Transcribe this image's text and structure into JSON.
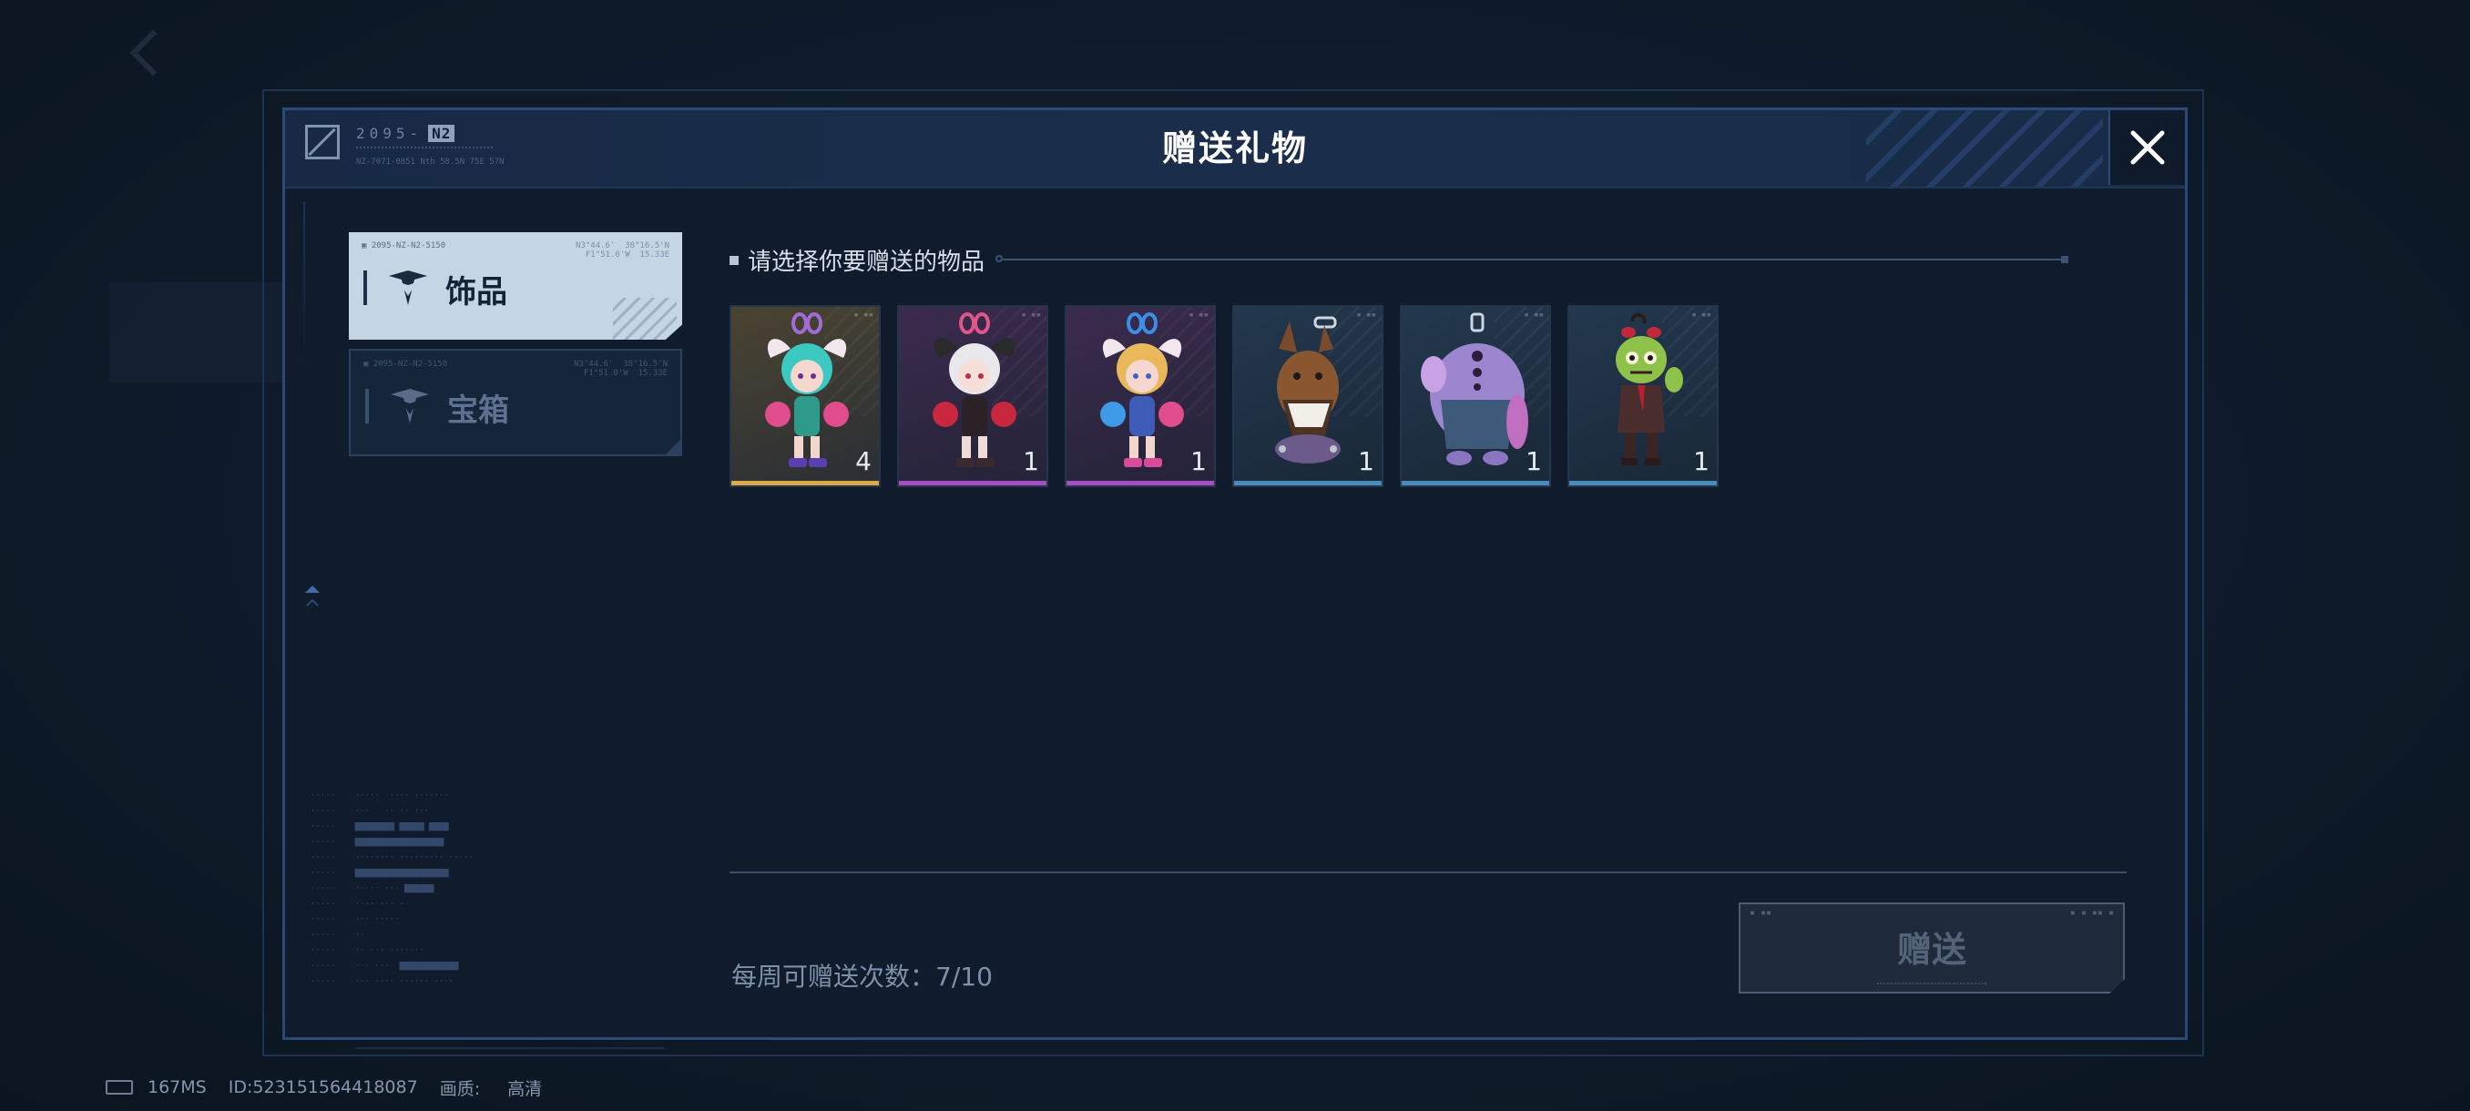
{
  "dialog": {
    "title": "赠送礼物",
    "close_icon": "close-icon",
    "logo": {
      "code": "2095-",
      "tag": "N2",
      "sub": "NZ-7071-0851 Nth 58.5N 75E 57N"
    }
  },
  "tabs": [
    {
      "label": "饰品",
      "icon": "emblem-icon",
      "active": true,
      "micro_left": "▣ 2095-NZ-N2-5150",
      "micro_right": "N3°44.6'  38°16.5'N\nF1°51.0'W  15.33E"
    },
    {
      "label": "宝箱",
      "icon": "emblem-icon",
      "active": false,
      "micro_left": "▣ 2095-NZ-N2-5150",
      "micro_right": "N3°44.6'  38°16.5'N\nF1°51.0'W  15.33E"
    }
  ],
  "prompt": "请选择你要赠送的物品",
  "items": [
    {
      "name": "cyan-bunny-pendant",
      "count": "4",
      "rarity": "gold",
      "rarity_color": "#d9a94a"
    },
    {
      "name": "white-bunny-pendant",
      "count": "1",
      "rarity": "purple",
      "rarity_color": "#a54fc2"
    },
    {
      "name": "blonde-bunny-pendant",
      "count": "1",
      "rarity": "purple",
      "rarity_color": "#a54fc2"
    },
    {
      "name": "dog-head-pendant",
      "count": "1",
      "rarity": "blue",
      "rarity_color": "#4a89b8"
    },
    {
      "name": "purple-monster-pendant",
      "count": "1",
      "rarity": "blue",
      "rarity_color": "#4a89b8"
    },
    {
      "name": "zombie-pendant",
      "count": "1",
      "rarity": "blue",
      "rarity_color": "#4a89b8"
    }
  ],
  "weekly": {
    "label": "每周可赠送次数：",
    "used": 7,
    "max": 10,
    "text": "7/10"
  },
  "send_button": {
    "label": "赠送",
    "enabled": false
  },
  "status": {
    "ping": "167MS",
    "id": "ID:523151564418087",
    "quality_label": "画质:",
    "quality_value": "高清"
  },
  "colors": {
    "dialog_border": "#2b4a78",
    "accent_active_tab": "#c4d5e4"
  }
}
